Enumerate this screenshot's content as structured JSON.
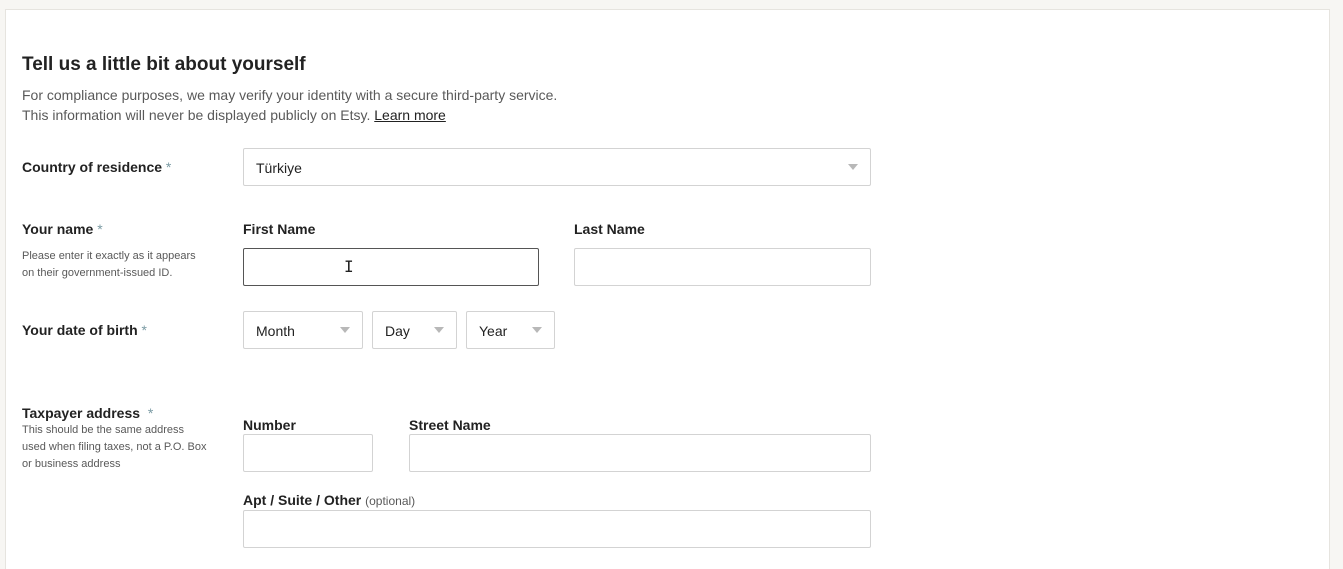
{
  "section": {
    "title": "Tell us a little bit about yourself",
    "desc_line1": "For compliance purposes, we may verify your identity with a secure third-party service.",
    "desc_line2": "This information will never be displayed publicly on Etsy.",
    "learn_more": "Learn more"
  },
  "country": {
    "label": "Country of residence",
    "required_mark": "*",
    "value": "Türkiye"
  },
  "name": {
    "label": "Your name",
    "required_mark": "*",
    "help": "Please enter it exactly as it appears on their government-issued ID.",
    "first_label": "First Name",
    "first_value": "",
    "last_label": "Last Name",
    "last_value": ""
  },
  "dob": {
    "label": "Your date of birth",
    "required_mark": "*",
    "month": "Month",
    "day": "Day",
    "year": "Year"
  },
  "address": {
    "label": "Taxpayer address",
    "required_mark": "*",
    "help": "This should be the same address used when filing taxes, not a P.O. Box or business address",
    "number_label": "Number",
    "street_label": "Street Name",
    "apt_label": "Apt / Suite / Other",
    "optional": "(optional)"
  },
  "colors": {
    "required": "#7a9aa3",
    "focus_border": "#555555",
    "border": "#d3d3d3"
  }
}
